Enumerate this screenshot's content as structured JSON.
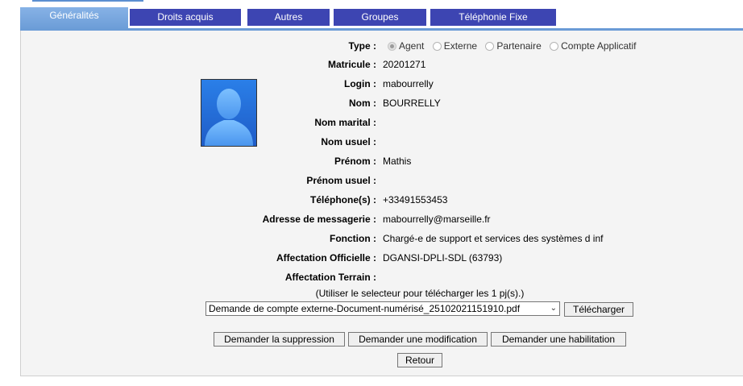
{
  "tabs": [
    {
      "label": "Généralités"
    },
    {
      "label": "Droits acquis"
    },
    {
      "label": "Autres"
    },
    {
      "label": "Groupes"
    },
    {
      "label": "Téléphonie Fixe"
    }
  ],
  "form": {
    "type_label": "Type :",
    "type_options": [
      "Agent",
      "Externe",
      "Partenaire",
      "Compte Applicatif"
    ],
    "type_selected": "Agent",
    "fields": [
      {
        "label": "Matricule :",
        "value": "20201271"
      },
      {
        "label": "Login :",
        "value": "mabourrelly"
      },
      {
        "label": "Nom :",
        "value": "BOURRELLY"
      },
      {
        "label": "Nom marital :",
        "value": ""
      },
      {
        "label": "Nom usuel :",
        "value": ""
      },
      {
        "label": "Prénom :",
        "value": "Mathis"
      },
      {
        "label": "Prénom usuel :",
        "value": ""
      },
      {
        "label": "Téléphone(s) :",
        "value": "+33491553453"
      },
      {
        "label": "Adresse de messagerie :",
        "value": "mabourrelly@marseille.fr"
      },
      {
        "label": "Fonction :",
        "value": "Chargé-e de support et services des systèmes d inf"
      },
      {
        "label": "Affectation Officielle :",
        "value": "DGANSI-DPLI-SDL (63793)"
      },
      {
        "label": "Affectation Terrain :",
        "value": ""
      }
    ]
  },
  "attachments": {
    "hint": "(Utiliser le selecteur pour télécharger les 1 pj(s).)",
    "selected_file": "Demande de compte externe-Document-numérisé_25102021151910.pdf",
    "download_label": "Télécharger"
  },
  "actions": {
    "delete_label": "Demander la suppression",
    "modify_label": "Demander une modification",
    "habilitation_label": "Demander une habilitation",
    "back_label": "Retour"
  },
  "icons": {
    "avatar": "user-silhouette-icon",
    "dropdown": "chevron-down-icon"
  }
}
